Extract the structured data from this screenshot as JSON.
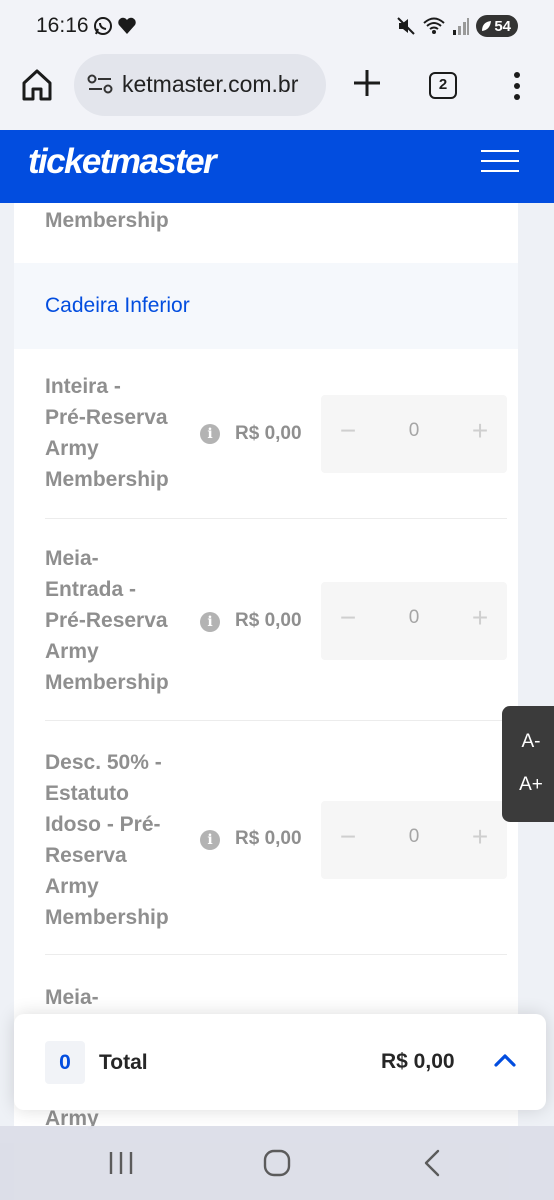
{
  "status_bar": {
    "time": "16:16",
    "battery": "54"
  },
  "browser": {
    "url": "ketmaster.com.br",
    "tab_count": "2"
  },
  "site": {
    "logo": "ticketmaster"
  },
  "content": {
    "partial_top_label": "Membership",
    "section_title": "Cadeira Inferior",
    "rows": [
      {
        "label_lines": [
          "Inteira -",
          "Pré-Reserva",
          "Army",
          "Membership"
        ],
        "price": "R$ 0,00",
        "quantity": "0",
        "minus": "−",
        "plus": "+"
      },
      {
        "label_lines": [
          "Meia-",
          "Entrada -",
          "Pré-Reserva",
          "Army",
          "Membership"
        ],
        "price": "R$ 0,00",
        "quantity": "0",
        "minus": "−",
        "plus": "+"
      },
      {
        "label_lines": [
          "Desc. 50% -",
          "Estatuto",
          "Idoso - Pré-",
          "Reserva",
          "Army",
          "Membership"
        ],
        "price": "R$ 0,00",
        "quantity": "0",
        "minus": "−",
        "plus": "+"
      }
    ],
    "partial_bottom_first": "Meia-",
    "partial_bottom_second": "Army",
    "info_glyph": "i"
  },
  "font_toggle": {
    "decrease": "A-",
    "increase": "A+"
  },
  "total_bar": {
    "count": "0",
    "label": "Total",
    "price": "R$ 0,00"
  }
}
